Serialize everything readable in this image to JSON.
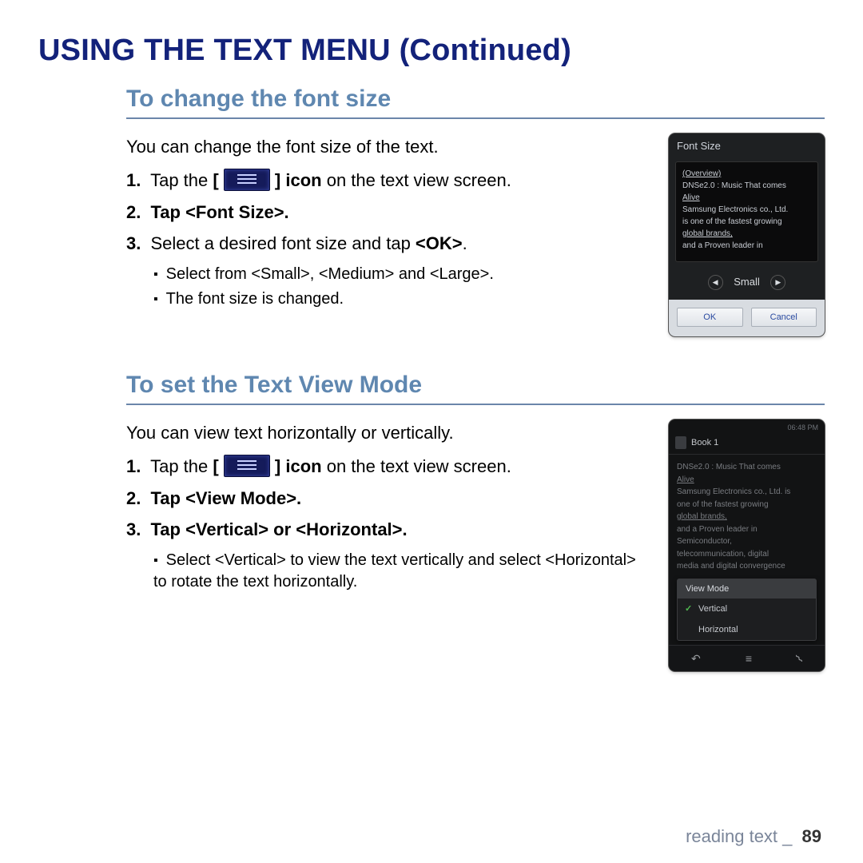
{
  "page_title": "USING THE TEXT MENU (Continued)",
  "sections": [
    {
      "heading": "To change the font size",
      "intro": "You can change the font size of the text.",
      "steps": [
        {
          "num": "1.",
          "prefix": "Tap the ",
          "show_icon": true,
          "suffix_bold": "] icon",
          "suffix_plain": " on the text view screen."
        },
        {
          "num": "2.",
          "bold_text": "Tap <Font Size>.",
          "plain_text": ""
        },
        {
          "num": "3.",
          "plain_start": "Select a desired font size and tap ",
          "bold_text": "<OK>",
          "plain_end": "."
        }
      ],
      "bullets": [
        "Select from <Small>, <Medium> and <Large>.",
        "The font size is changed."
      ],
      "mock": {
        "title": "Font Size",
        "body_lines": [
          "(Overview)",
          "DNSe2.0 : Music That comes",
          "Alive",
          "Samsung Electronics co., Ltd.",
          "is one of the fastest growing",
          "global brands,",
          "and a Proven leader in"
        ],
        "selector_value": "Small",
        "ok": "OK",
        "cancel": "Cancel"
      }
    },
    {
      "heading": "To set the Text View Mode",
      "intro": "You can view text horizontally or vertically.",
      "steps": [
        {
          "num": "1.",
          "prefix": "Tap the ",
          "show_icon": true,
          "suffix_bold": "] icon",
          "suffix_plain": " on the text view screen."
        },
        {
          "num": "2.",
          "bold_text": "Tap <View Mode>.",
          "plain_text": ""
        },
        {
          "num": "3.",
          "bold_text": "Tap <Vertical> or <Horizontal>.",
          "plain_text": ""
        }
      ],
      "bullets": [
        "Select <Vertical> to view the text vertically and select <Horizontal> to rotate the text horizontally."
      ],
      "mock": {
        "time": "06:48 PM",
        "title": "Book 1",
        "body_lines": [
          "DNSe2.0 : Music That comes",
          "Alive",
          "Samsung Electronics co., Ltd. is",
          "one of the fastest growing",
          "global brands,",
          "and a Proven leader in",
          "Semiconductor,",
          "telecommunication, digital",
          "media and digital convergence"
        ],
        "popup_title": "View Mode",
        "popup_opt1": "Vertical",
        "popup_opt2": "Horizontal"
      }
    }
  ],
  "footer": {
    "label": "reading text _",
    "page": "89"
  }
}
